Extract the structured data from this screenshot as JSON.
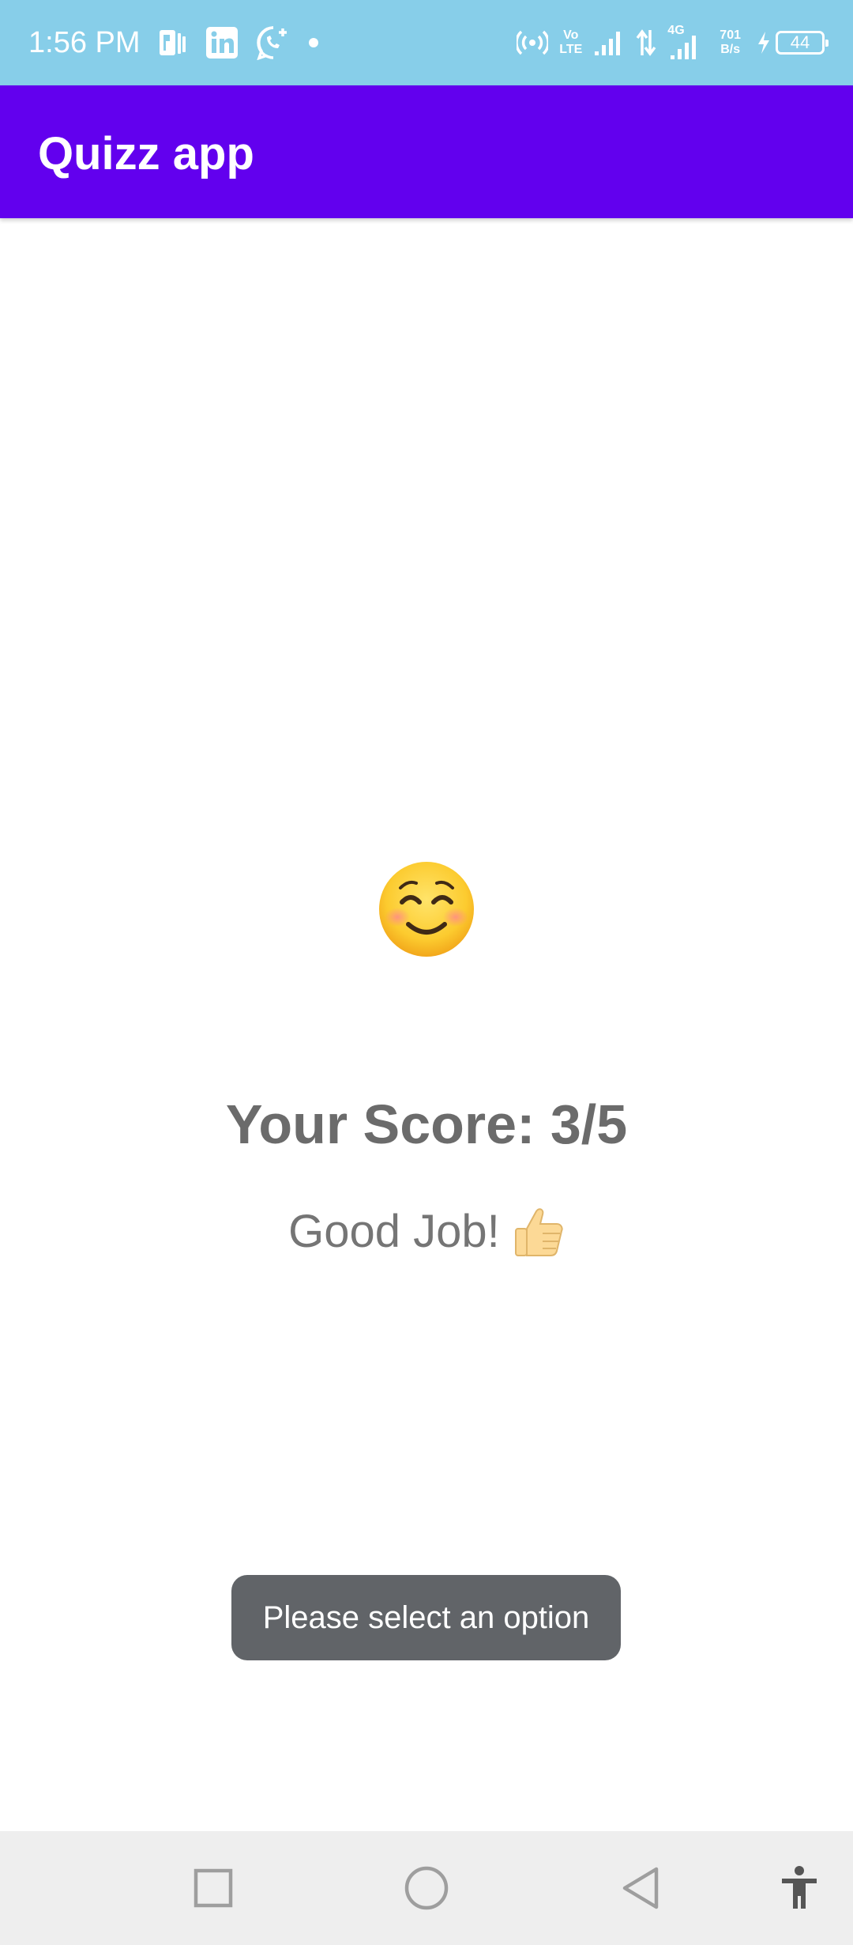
{
  "status_bar": {
    "time": "1:56 PM",
    "network_speed_top": "701",
    "network_speed_bottom": "B/s",
    "volte_top": "Vo",
    "volte_bottom": "LTE",
    "network_type": "4G",
    "battery_level": "44",
    "background_color": "#87cee9"
  },
  "app_bar": {
    "title": "Quizz app",
    "color": "#6200ee"
  },
  "result": {
    "emoji_icon": "smiling-face-with-smiling-eyes-icon",
    "score_text": "Your Score: 3/5",
    "message": "Good Job!",
    "message_icon": "thumbs-up-icon",
    "text_color": "#6b6b6b"
  },
  "toast": {
    "text": "Please select an option",
    "color": "#616468"
  },
  "nav_bar": {
    "buttons": [
      "recents-square-icon",
      "home-circle-icon",
      "back-triangle-icon",
      "accessibility-icon"
    ]
  }
}
